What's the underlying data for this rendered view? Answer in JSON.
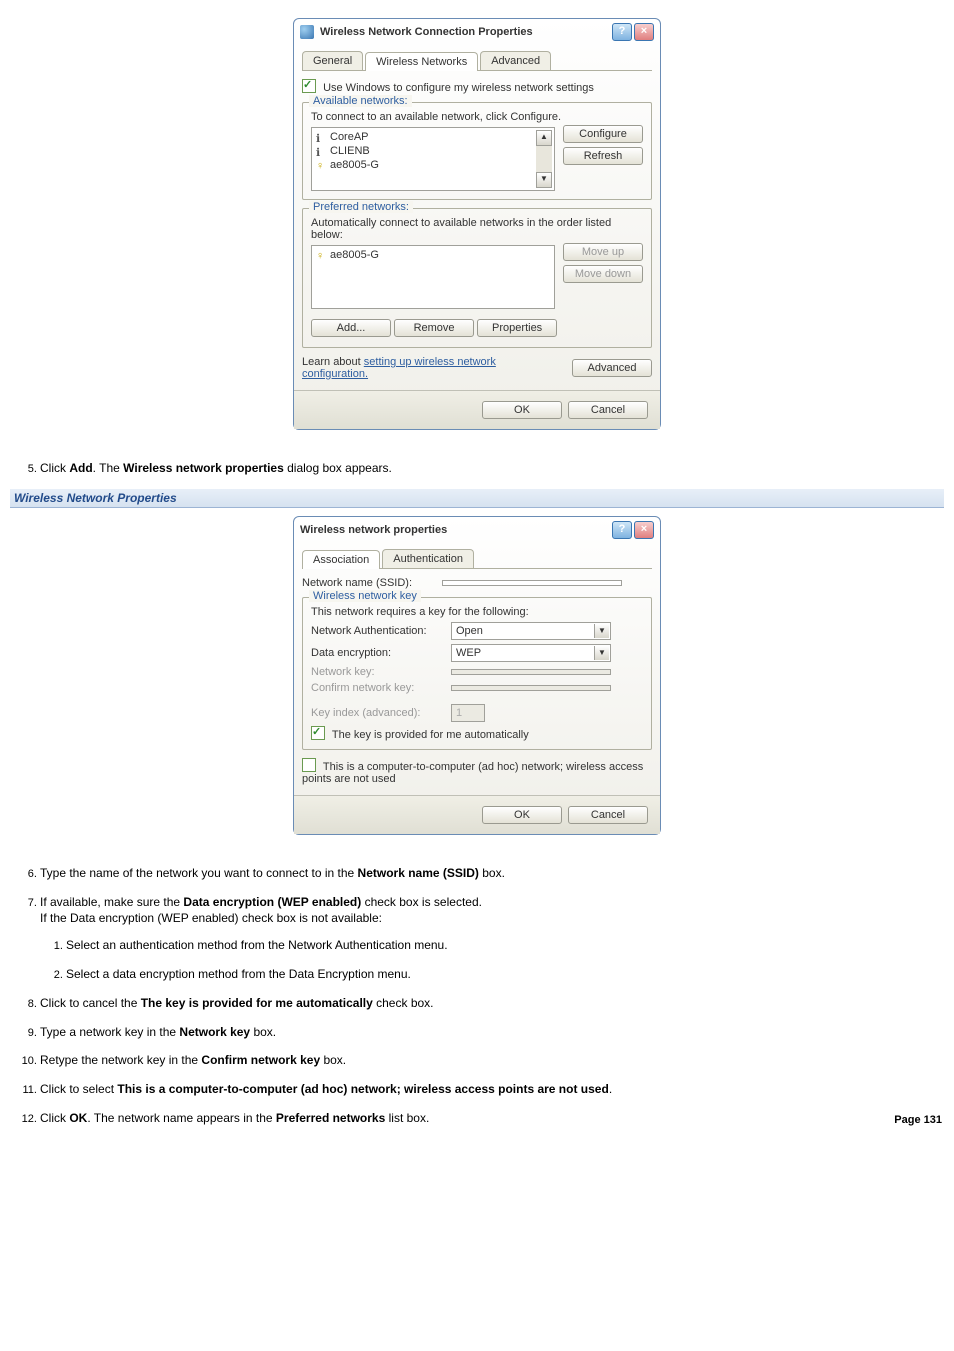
{
  "dialog1": {
    "title": "Wireless Network Connection Properties",
    "tabs": {
      "general": "General",
      "wireless": "Wireless Networks",
      "advanced": "Advanced"
    },
    "use_windows_label": "Use Windows to configure my wireless network settings",
    "available": {
      "legend": "Available networks:",
      "note": "To connect to an available network, click Configure.",
      "items": [
        "CoreAP",
        "CLIENB",
        "ae8005-G"
      ],
      "configure_btn": "Configure",
      "refresh_btn": "Refresh"
    },
    "preferred": {
      "legend": "Preferred networks:",
      "note": "Automatically connect to available networks in the order listed below:",
      "items": [
        "ae8005-G"
      ],
      "moveup_btn": "Move up",
      "movedown_btn": "Move down",
      "add_btn": "Add...",
      "remove_btn": "Remove",
      "properties_btn": "Properties"
    },
    "learn_text1": "Learn about ",
    "learn_link": "setting up wireless network configuration.",
    "advanced_btn": "Advanced",
    "ok_btn": "OK",
    "cancel_btn": "Cancel"
  },
  "step5": {
    "pre": "Click ",
    "b1": "Add",
    "mid": ". The ",
    "b2": "Wireless network properties",
    "post": " dialog box appears."
  },
  "section_header": "Wireless Network Properties",
  "dialog2": {
    "title": "Wireless network properties",
    "tabs": {
      "assoc": "Association",
      "auth": "Authentication"
    },
    "ssid_label": "Network name (SSID):",
    "key_legend": "Wireless network key",
    "key_note": "This network requires a key for the following:",
    "auth_label": "Network Authentication:",
    "auth_value": "Open",
    "enc_label": "Data encryption:",
    "enc_value": "WEP",
    "netkey_label": "Network key:",
    "confirm_label": "Confirm network key:",
    "keyindex_label": "Key index (advanced):",
    "keyindex_value": "1",
    "auto_label": "The key is provided for me automatically",
    "adhoc_label": "This is a computer-to-computer (ad hoc) network; wireless access points are not used",
    "ok_btn": "OK",
    "cancel_btn": "Cancel"
  },
  "step6": {
    "pre": "Type the name of the network you want to connect to in the ",
    "b1": "Network name (SSID)",
    "post": " box."
  },
  "step7": {
    "pre": "If available, make sure the ",
    "b1": "Data encryption (WEP enabled)",
    "post": " check box is selected.",
    "line2": "If the Data encryption (WEP enabled) check box is not available:",
    "sub1": "Select an authentication method from the Network Authentication menu.",
    "sub2": "Select a data encryption method from the Data Encryption menu."
  },
  "step8": {
    "pre": "Click to cancel the ",
    "b1": "The key is provided for me automatically",
    "post": " check box."
  },
  "step9": {
    "pre": "Type a network key in the ",
    "b1": "Network key",
    "post": " box."
  },
  "step10": {
    "pre": "Retype the network key in the ",
    "b1": "Confirm network key",
    "post": " box."
  },
  "step11": {
    "pre": "Click to select ",
    "b1": "This is a computer-to-computer (ad hoc) network; wireless access points are not used",
    "post": "."
  },
  "step12": {
    "pre": "Click ",
    "b1": "OK",
    "mid": ". The network name appears in the ",
    "b2": "Preferred networks",
    "post": " list box."
  },
  "page_number": "Page 131"
}
